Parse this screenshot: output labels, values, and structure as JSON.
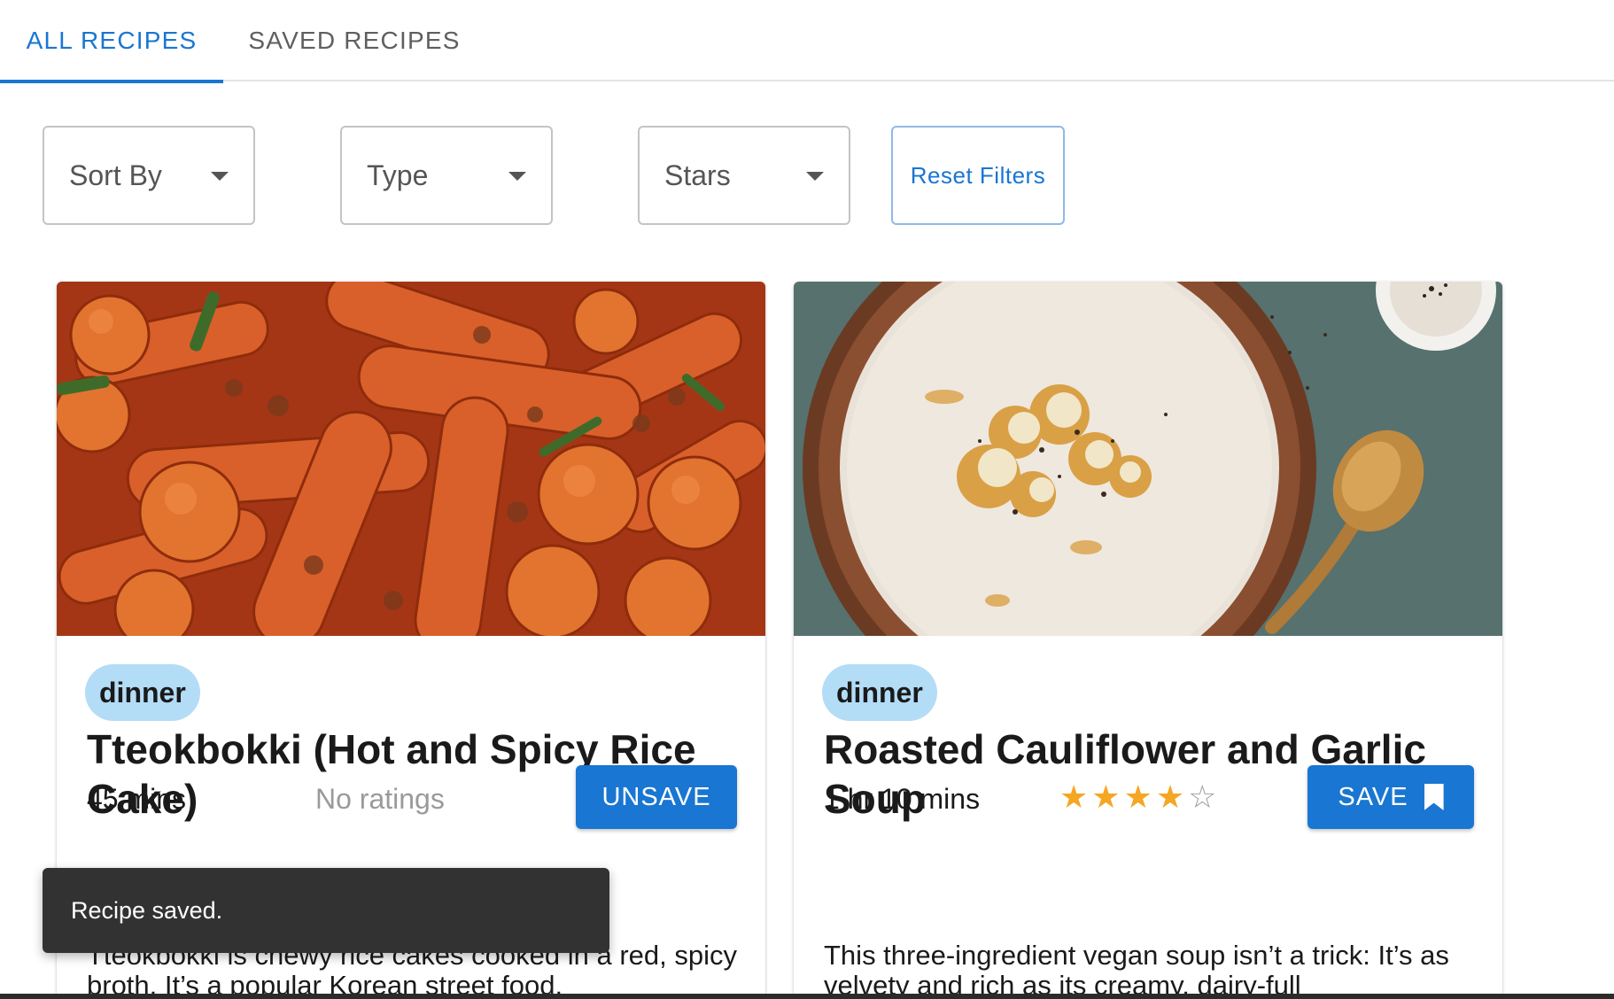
{
  "tabs": {
    "all": "ALL RECIPES",
    "saved": "SAVED RECIPES",
    "active": "all"
  },
  "filters": {
    "sort_by": "Sort By",
    "type": "Type",
    "stars": "Stars",
    "reset": "Reset Filters"
  },
  "recipes": [
    {
      "category": "dinner",
      "title": "Tteokbokki (Hot and Spicy Rice Cake)",
      "time": "45 mins",
      "rating_text": "No ratings",
      "button": "UNSAVE",
      "description": "Tteokbokki is chewy rice cakes cooked in a red, spicy broth. It’s a popular Korean street food."
    },
    {
      "category": "dinner",
      "title": "Roasted Cauliflower and Garlic Soup",
      "time": "1 hr 10 mins",
      "rating": 4,
      "rating_max": 5,
      "button": "SAVE",
      "description": "This three-ingredient vegan soup isn’t a trick: It’s as velvety and rich as its creamy, dairy-full"
    }
  ],
  "snackbar": {
    "message": "Recipe saved."
  },
  "colors": {
    "accent": "#1976d2",
    "chip": "#b3dcf7",
    "star": "#f5a623",
    "snackbar": "#323232"
  },
  "icons": [
    "caret-down-icon",
    "bookmark-icon",
    "star-icon"
  ]
}
